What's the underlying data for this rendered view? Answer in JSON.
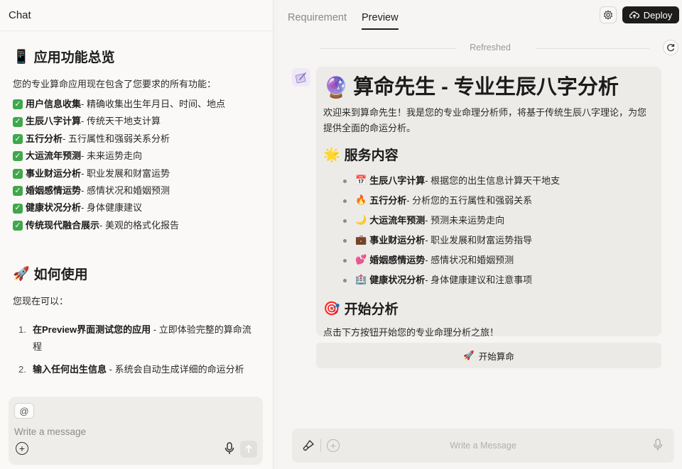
{
  "left": {
    "title": "Chat",
    "section1": {
      "icon": "📱",
      "title": "应用功能总览"
    },
    "summary": "您的专业算命应用现在包含了您要求的所有功能：",
    "features": [
      {
        "bold": "用户信息收集",
        "rest": " - 精确收集出生年月日、时间、地点"
      },
      {
        "bold": "生辰八字计算",
        "rest": " - 传统天干地支计算"
      },
      {
        "bold": "五行分析",
        "rest": " - 五行属性和强弱关系分析"
      },
      {
        "bold": "大运流年预测",
        "rest": " - 未来运势走向"
      },
      {
        "bold": "事业财运分析",
        "rest": " - 职业发展和财富运势"
      },
      {
        "bold": "婚姻感情运势",
        "rest": " - 感情状况和婚姻预测"
      },
      {
        "bold": "健康状况分析",
        "rest": " - 身体健康建议"
      },
      {
        "bold": "传统现代融合展示",
        "rest": " - 美观的格式化报告"
      }
    ],
    "section2": {
      "icon": "🚀",
      "title": "如何使用"
    },
    "can_now": "您现在可以：",
    "steps": [
      {
        "num": "1.",
        "bold": "在Preview界面测试您的应用",
        "rest": " - 立即体验完整的算命流程"
      },
      {
        "num": "2.",
        "bold": "输入任何出生信息",
        "rest": " - 系统会自动生成详细的命运分析"
      }
    ],
    "composer": {
      "mention": "@",
      "placeholder": "Write a message"
    }
  },
  "right": {
    "tabs": [
      {
        "label": "Requirement",
        "active": false
      },
      {
        "label": "Preview",
        "active": true
      }
    ],
    "deploy_label": "Deploy",
    "refreshed": "Refreshed",
    "card": {
      "title_icon": "🔮",
      "title": "算命先生 - 专业生辰八字分析",
      "intro": "欢迎来到算命先生！我是您的专业命理分析师，将基于传统生辰八字理论，为您提供全面的命运分析。",
      "services_icon": "🌟",
      "services_title": "服务内容",
      "services": [
        {
          "icon": "📅",
          "bold": "生辰八字计算",
          "rest": " - 根据您的出生信息计算天干地支"
        },
        {
          "icon": "🔥",
          "bold": "五行分析",
          "rest": " - 分析您的五行属性和强弱关系"
        },
        {
          "icon": "🌙",
          "bold": "大运流年预测",
          "rest": " - 预测未来运势走向"
        },
        {
          "icon": "💼",
          "bold": "事业财运分析",
          "rest": " - 职业发展和财富运势指导"
        },
        {
          "icon": "💕",
          "bold": "婚姻感情运势",
          "rest": " - 感情状况和婚姻预测"
        },
        {
          "icon": "🏥",
          "bold": "健康状况分析",
          "rest": " - 身体健康建议和注意事项"
        }
      ],
      "start_icon": "🎯",
      "start_title": "开始分析",
      "start_text": "点击下方按钮开始您的专业命理分析之旅！"
    },
    "start_button": {
      "icon": "🚀",
      "label": "开始算命"
    },
    "composer_placeholder": "Write a Message"
  }
}
